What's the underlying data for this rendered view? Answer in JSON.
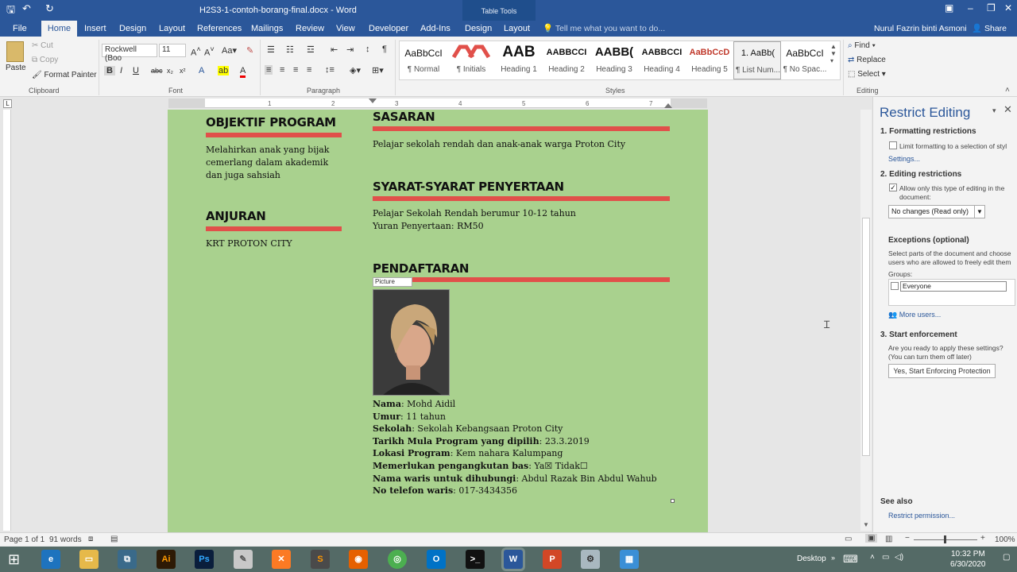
{
  "titlebar": {
    "document": "H2S3-1-contoh-borang-final.docx - Word",
    "tabletools": "Table Tools"
  },
  "tabs": [
    "File",
    "Home",
    "Insert",
    "Design",
    "Layout",
    "References",
    "Mailings",
    "Review",
    "View",
    "Developer",
    "Add-Ins",
    "Design",
    "Layout"
  ],
  "tellme": "Tell me what you want to do...",
  "user": "Nurul Fazrin binti Asmoni",
  "share": "Share",
  "clipboard": {
    "paste": "Paste",
    "cut": "Cut",
    "copy": "Copy",
    "format_painter": "Format Painter",
    "label": "Clipboard"
  },
  "font": {
    "name": "Rockwell (Boo",
    "size": "11",
    "label": "Font"
  },
  "paragraph": {
    "label": "Paragraph"
  },
  "styles": {
    "label": "Styles",
    "items": [
      {
        "preview": "AaBbCcI",
        "name": "¶ Normal"
      },
      {
        "preview": "",
        "name": "¶ Initials"
      },
      {
        "preview": "AAB",
        "name": "Heading 1"
      },
      {
        "preview": "AABBCCI",
        "name": "Heading 2"
      },
      {
        "preview": "AABB(",
        "name": "Heading 3"
      },
      {
        "preview": "AABBCCI",
        "name": "Heading 4"
      },
      {
        "preview": "AaBbCcD",
        "name": "Heading 5"
      },
      {
        "preview": "1. AaBb(",
        "name": "¶ List Num..."
      },
      {
        "preview": "AaBbCcI",
        "name": "¶ No Spac..."
      }
    ]
  },
  "editing": {
    "find": "Find",
    "replace": "Replace",
    "select": "Select",
    "label": "Editing"
  },
  "doc": {
    "objektif_title": "OBJEKTIF PROGRAM",
    "objektif_text": [
      "Melahirkan anak yang bijak",
      "cemerlang dalam akademik",
      "dan juga sahsiah"
    ],
    "anjuran_title": "ANJURAN",
    "anjuran_text": "KRT PROTON CITY",
    "sasaran_title": "SASARAN",
    "sasaran_text": "Pelajar sekolah rendah dan anak-anak warga Proton City",
    "syarat_title": "SYARAT-SYARAT PENYERTAAN",
    "syarat_text": [
      "Pelajar Sekolah Rendah berumur 10-12 tahun",
      "Yuran Penyertaan: RM50"
    ],
    "pendaftaran_title": "PENDAFTARAN",
    "picture_label": "Picture",
    "fields": [
      {
        "label": "Nama",
        "value": ": Mohd Aidil"
      },
      {
        "label": "Umur",
        "value": ": 11 tahun"
      },
      {
        "label": "Sekolah",
        "value": ": Sekolah Kebangsaan Proton City"
      },
      {
        "label": "Tarikh Mula Program yang dipilih",
        "value": ": 23.3.2019"
      },
      {
        "label": "Lokasi Program",
        "value": ": Kem nahara Kalumpang"
      },
      {
        "label": "Memerlukan pengangkutan bas",
        "value": ": Ya☒   Tidak☐"
      },
      {
        "label": "Nama waris untuk dihubungi",
        "value": ": Abdul Razak Bin Abdul Wahub"
      },
      {
        "label": "No telefon waris",
        "value": ": 017-3434356"
      }
    ]
  },
  "pane": {
    "title": "Restrict Editing",
    "s1": "1. Formatting restrictions",
    "s1_check": "Limit formatting to a selection of styl",
    "settings": "Settings...",
    "s2": "2. Editing restrictions",
    "s2_check": "Allow only this type of editing in the document:",
    "s2_select": "No changes (Read only)",
    "exceptions": "Exceptions (optional)",
    "exceptions_text": "Select parts of the document and choose users who are allowed to freely edit them",
    "groups": "Groups:",
    "everyone": "Everyone",
    "more_users": "More users...",
    "s3": "3. Start enforcement",
    "s3_text": "Are you ready to apply these settings? (You can turn them off later)",
    "enforce_button": "Yes, Start Enforcing Protection",
    "see_also": "See also",
    "restrict_permission": "Restrict permission..."
  },
  "status": {
    "page": "Page 1 of 1",
    "words": "91 words",
    "zoom": "100%"
  },
  "taskbar": {
    "desktop": "Desktop",
    "time": "10:32 PM",
    "date": "6/30/2020"
  }
}
